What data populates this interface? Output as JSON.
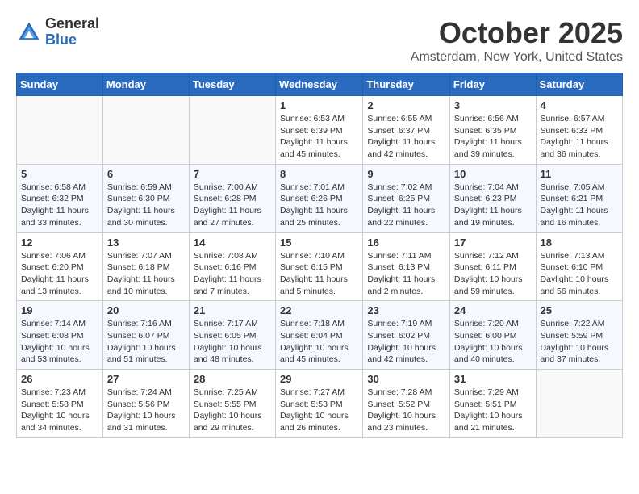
{
  "logo": {
    "general": "General",
    "blue": "Blue"
  },
  "title": "October 2025",
  "location": "Amsterdam, New York, United States",
  "days_of_week": [
    "Sunday",
    "Monday",
    "Tuesday",
    "Wednesday",
    "Thursday",
    "Friday",
    "Saturday"
  ],
  "weeks": [
    [
      {
        "day": "",
        "info": ""
      },
      {
        "day": "",
        "info": ""
      },
      {
        "day": "",
        "info": ""
      },
      {
        "day": "1",
        "info": "Sunrise: 6:53 AM\nSunset: 6:39 PM\nDaylight: 11 hours and 45 minutes."
      },
      {
        "day": "2",
        "info": "Sunrise: 6:55 AM\nSunset: 6:37 PM\nDaylight: 11 hours and 42 minutes."
      },
      {
        "day": "3",
        "info": "Sunrise: 6:56 AM\nSunset: 6:35 PM\nDaylight: 11 hours and 39 minutes."
      },
      {
        "day": "4",
        "info": "Sunrise: 6:57 AM\nSunset: 6:33 PM\nDaylight: 11 hours and 36 minutes."
      }
    ],
    [
      {
        "day": "5",
        "info": "Sunrise: 6:58 AM\nSunset: 6:32 PM\nDaylight: 11 hours and 33 minutes."
      },
      {
        "day": "6",
        "info": "Sunrise: 6:59 AM\nSunset: 6:30 PM\nDaylight: 11 hours and 30 minutes."
      },
      {
        "day": "7",
        "info": "Sunrise: 7:00 AM\nSunset: 6:28 PM\nDaylight: 11 hours and 27 minutes."
      },
      {
        "day": "8",
        "info": "Sunrise: 7:01 AM\nSunset: 6:26 PM\nDaylight: 11 hours and 25 minutes."
      },
      {
        "day": "9",
        "info": "Sunrise: 7:02 AM\nSunset: 6:25 PM\nDaylight: 11 hours and 22 minutes."
      },
      {
        "day": "10",
        "info": "Sunrise: 7:04 AM\nSunset: 6:23 PM\nDaylight: 11 hours and 19 minutes."
      },
      {
        "day": "11",
        "info": "Sunrise: 7:05 AM\nSunset: 6:21 PM\nDaylight: 11 hours and 16 minutes."
      }
    ],
    [
      {
        "day": "12",
        "info": "Sunrise: 7:06 AM\nSunset: 6:20 PM\nDaylight: 11 hours and 13 minutes."
      },
      {
        "day": "13",
        "info": "Sunrise: 7:07 AM\nSunset: 6:18 PM\nDaylight: 11 hours and 10 minutes."
      },
      {
        "day": "14",
        "info": "Sunrise: 7:08 AM\nSunset: 6:16 PM\nDaylight: 11 hours and 7 minutes."
      },
      {
        "day": "15",
        "info": "Sunrise: 7:10 AM\nSunset: 6:15 PM\nDaylight: 11 hours and 5 minutes."
      },
      {
        "day": "16",
        "info": "Sunrise: 7:11 AM\nSunset: 6:13 PM\nDaylight: 11 hours and 2 minutes."
      },
      {
        "day": "17",
        "info": "Sunrise: 7:12 AM\nSunset: 6:11 PM\nDaylight: 10 hours and 59 minutes."
      },
      {
        "day": "18",
        "info": "Sunrise: 7:13 AM\nSunset: 6:10 PM\nDaylight: 10 hours and 56 minutes."
      }
    ],
    [
      {
        "day": "19",
        "info": "Sunrise: 7:14 AM\nSunset: 6:08 PM\nDaylight: 10 hours and 53 minutes."
      },
      {
        "day": "20",
        "info": "Sunrise: 7:16 AM\nSunset: 6:07 PM\nDaylight: 10 hours and 51 minutes."
      },
      {
        "day": "21",
        "info": "Sunrise: 7:17 AM\nSunset: 6:05 PM\nDaylight: 10 hours and 48 minutes."
      },
      {
        "day": "22",
        "info": "Sunrise: 7:18 AM\nSunset: 6:04 PM\nDaylight: 10 hours and 45 minutes."
      },
      {
        "day": "23",
        "info": "Sunrise: 7:19 AM\nSunset: 6:02 PM\nDaylight: 10 hours and 42 minutes."
      },
      {
        "day": "24",
        "info": "Sunrise: 7:20 AM\nSunset: 6:00 PM\nDaylight: 10 hours and 40 minutes."
      },
      {
        "day": "25",
        "info": "Sunrise: 7:22 AM\nSunset: 5:59 PM\nDaylight: 10 hours and 37 minutes."
      }
    ],
    [
      {
        "day": "26",
        "info": "Sunrise: 7:23 AM\nSunset: 5:58 PM\nDaylight: 10 hours and 34 minutes."
      },
      {
        "day": "27",
        "info": "Sunrise: 7:24 AM\nSunset: 5:56 PM\nDaylight: 10 hours and 31 minutes."
      },
      {
        "day": "28",
        "info": "Sunrise: 7:25 AM\nSunset: 5:55 PM\nDaylight: 10 hours and 29 minutes."
      },
      {
        "day": "29",
        "info": "Sunrise: 7:27 AM\nSunset: 5:53 PM\nDaylight: 10 hours and 26 minutes."
      },
      {
        "day": "30",
        "info": "Sunrise: 7:28 AM\nSunset: 5:52 PM\nDaylight: 10 hours and 23 minutes."
      },
      {
        "day": "31",
        "info": "Sunrise: 7:29 AM\nSunset: 5:51 PM\nDaylight: 10 hours and 21 minutes."
      },
      {
        "day": "",
        "info": ""
      }
    ]
  ]
}
